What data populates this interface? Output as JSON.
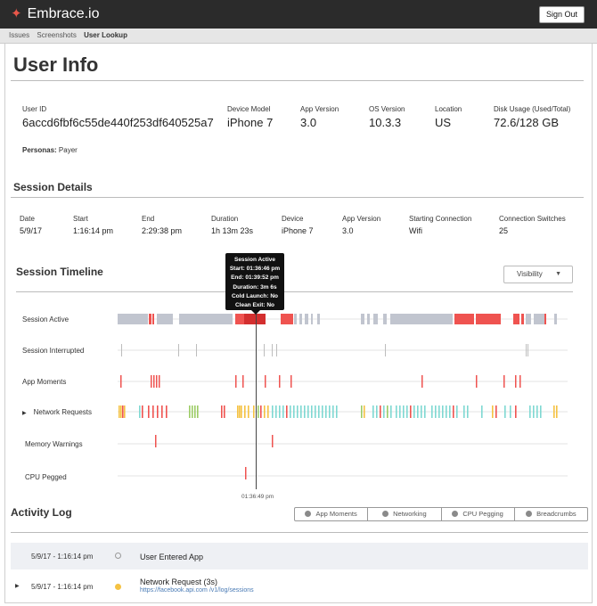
{
  "app": {
    "brand": "Embrace.io",
    "logo_icon": "embrace-star-icon",
    "sign_out": "Sign Out"
  },
  "nav": {
    "items": [
      "Issues",
      "Screenshots",
      "User Lookup"
    ],
    "active": "User Lookup"
  },
  "page": {
    "title": "User Info"
  },
  "user": {
    "id_label": "User ID",
    "id_value": "6accd6fbf6c55de440f253df640525a7",
    "device_label": "Device Model",
    "device_value": "iPhone 7",
    "app_version_label": "App Version",
    "app_version_value": "3.0",
    "os_label": "OS Version",
    "os_value": "10.3.3",
    "location_label": "Location",
    "location_value": "US",
    "disk_label": "Disk Usage (Used/Total)",
    "disk_value": "72.6/128 GB",
    "personas_label": "Personas:",
    "personas_value": "Payer"
  },
  "session": {
    "title": "Session Details",
    "date_label": "Date",
    "date_value": "5/9/17",
    "start_label": "Start",
    "start_value": "1:16:14 pm",
    "end_label": "End",
    "end_value": "2:29:38 pm",
    "duration_label": "Duration",
    "duration_value": "1h 13m 23s",
    "device_label": "Device",
    "device_value": "iPhone 7",
    "app_version_label": "App Version",
    "app_version_value": "3.0",
    "conn_label": "Starting Connection",
    "conn_value": "Wifi",
    "switches_label": "Connection Switches",
    "switches_value": "25"
  },
  "timeline": {
    "title": "Session Timeline",
    "visibility": "Visibility",
    "rows": [
      "Session Active",
      "Session Interrupted",
      "App Moments",
      "Network Requests",
      "Memory Warnings",
      "CPU Pegged"
    ],
    "tooltip": {
      "title": "Session Active",
      "start_label": "Start:",
      "start_value": "01:36:46 pm",
      "end_label": "End:",
      "end_value": "01:39:52 pm",
      "duration_label": "Duration:",
      "duration_value": "3m 6s",
      "cold_label": "Cold Launch:",
      "cold_value": "No",
      "clean_label": "Clean Exit:",
      "clean_value": "No"
    },
    "cursor_time": "01:36:49 pm",
    "colors": {
      "active": "#c1c5cf",
      "crash": "#ef5350",
      "selected": "#d32f2f",
      "cyan": "#7fd8d2",
      "yellow": "#f5c242",
      "green": "#9ccc65"
    }
  },
  "activity": {
    "title": "Activity Log",
    "filters": [
      "App Moments",
      "Networking",
      "CPU Pegging",
      "Breadcrumbs"
    ],
    "entries": [
      {
        "time": "5/9/17 - 1:16:14 pm",
        "text": "User Entered App",
        "link": ""
      },
      {
        "time": "5/9/17 - 1:16:14 pm",
        "text": "Network Request (3s)",
        "link": "https://facebook.api.com /v1/log/sessions"
      }
    ]
  }
}
